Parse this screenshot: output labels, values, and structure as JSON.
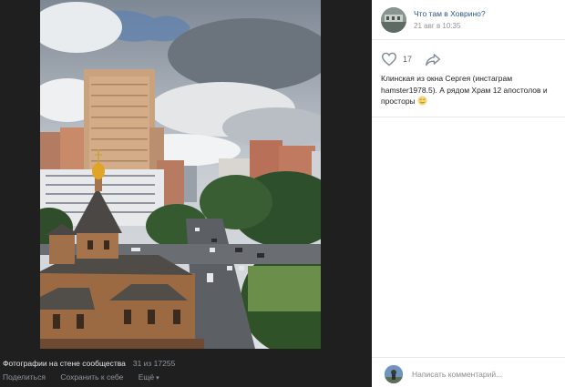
{
  "viewer": {
    "album_title": "Фотографии на стене сообщества",
    "counter": "31 из 17255",
    "actions": {
      "share": "Поделиться",
      "save": "Сохранить к себе",
      "more": "Ещё"
    }
  },
  "post": {
    "group_name": "Что там в Ховрино?",
    "date": "21 авг в 10:35",
    "likes": "17",
    "text": "Клинская из окна Сергея (инстаграм hamster1978.5). А рядом Храм 12 апостолов и просторы",
    "emoji_icon": "smiling-face-emoji-icon"
  },
  "comment": {
    "placeholder": "Написать комментарий..."
  },
  "colors": {
    "viewer_bg": "#1f1f1f",
    "link": "#2a5885",
    "muted": "#939393"
  }
}
